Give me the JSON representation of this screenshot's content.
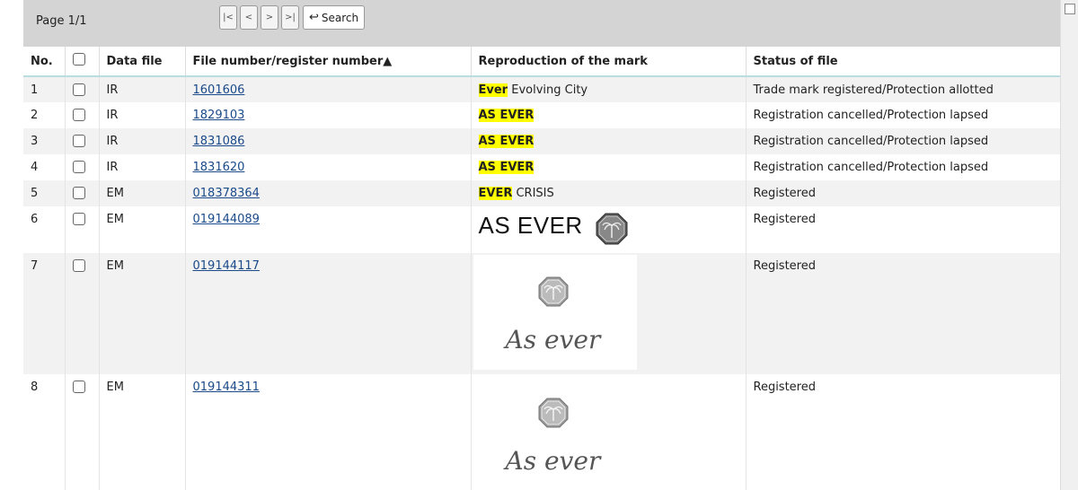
{
  "pager": {
    "page_label": "Page 1/1",
    "buttons": [
      "|<",
      "<",
      ">",
      ">|"
    ],
    "search_label": "Search"
  },
  "table": {
    "headers": {
      "no": "No.",
      "data_file": "Data file",
      "file_number": "File number/register number▲",
      "reproduction": "Reproduction of the mark",
      "status": "Status of file"
    },
    "rows": [
      {
        "no": "1",
        "data_file": "IR",
        "file_number": "1601606",
        "mark_hl": "Ever",
        "mark_rest": " Evolving City",
        "status": "Trade mark registered/Protection allotted"
      },
      {
        "no": "2",
        "data_file": "IR",
        "file_number": "1829103",
        "mark_hl": "AS EVER",
        "mark_rest": "",
        "status": "Registration cancelled/Protection lapsed"
      },
      {
        "no": "3",
        "data_file": "IR",
        "file_number": "1831086",
        "mark_hl": "AS EVER",
        "mark_rest": "",
        "status": "Registration cancelled/Protection lapsed"
      },
      {
        "no": "4",
        "data_file": "IR",
        "file_number": "1831620",
        "mark_hl": "AS EVER",
        "mark_rest": "",
        "status": "Registration cancelled/Protection lapsed"
      },
      {
        "no": "5",
        "data_file": "EM",
        "file_number": "018378364",
        "mark_hl": "EVER",
        "mark_rest": " CRISIS",
        "status": "Registered"
      },
      {
        "no": "6",
        "data_file": "EM",
        "file_number": "019144089",
        "mark_image_text": "AS EVER",
        "status": "Registered"
      },
      {
        "no": "7",
        "data_file": "EM",
        "file_number": "019144117",
        "mark_image_script": "As ever",
        "status": "Registered"
      },
      {
        "no": "8",
        "data_file": "EM",
        "file_number": "019144311",
        "mark_image_script": "As ever",
        "status": "Registered"
      }
    ]
  }
}
